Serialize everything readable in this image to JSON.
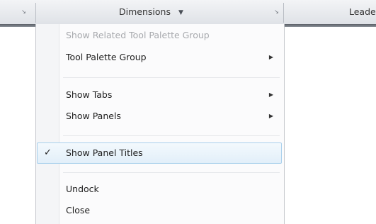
{
  "ribbon": {
    "panel_title": "Dimensions",
    "next_panel_title": "Leaders"
  },
  "menu": {
    "items": [
      {
        "label": "Show Related Tool Palette Group",
        "enabled": false
      },
      {
        "label": "Tool Palette Group",
        "has_submenu": true
      },
      {
        "label": "Show Tabs",
        "has_submenu": true
      },
      {
        "label": "Show Panels",
        "has_submenu": true
      },
      {
        "label": "Show Panel Titles",
        "checked": true
      },
      {
        "label": "Undock"
      },
      {
        "label": "Close"
      }
    ],
    "check_glyph": "✓",
    "submenu_glyph": "▶"
  },
  "icons": {
    "launcher": "dialog-launcher-icon",
    "dropdown": "caret-down-icon"
  }
}
